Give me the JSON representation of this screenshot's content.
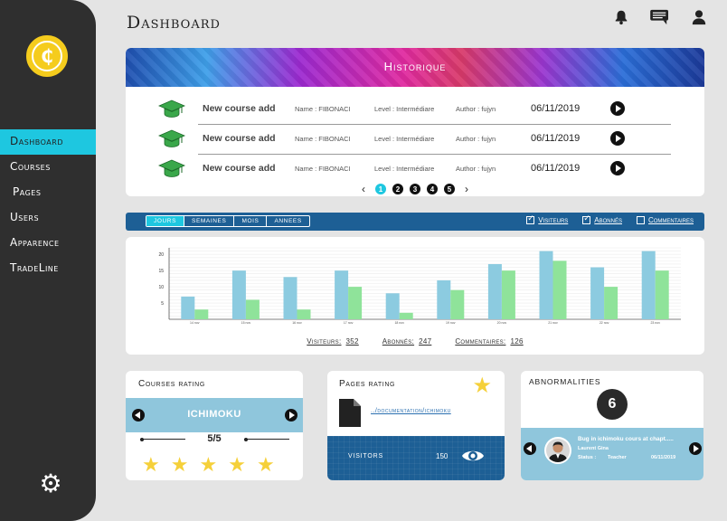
{
  "app": {
    "page_title": "Dashboard",
    "logo_symbol": "₵"
  },
  "sidebar": {
    "items": [
      {
        "label": "Dashboard",
        "active": true
      },
      {
        "label": "Courses"
      },
      {
        "label": "Pages"
      },
      {
        "label": "Users"
      },
      {
        "label": "Apparence"
      },
      {
        "label": "TradeLine"
      }
    ],
    "settings_icon": "gear-icon"
  },
  "header": {
    "icons": [
      "bell-icon",
      "chat-icon",
      "user-icon"
    ]
  },
  "historique": {
    "title": "Historique",
    "rows": [
      {
        "title": "New course add",
        "name": "Name : FIBONACI",
        "level": "Level : Intermédiare",
        "author": "Author : fujyn",
        "date": "06/11/2019"
      },
      {
        "title": "New course add",
        "name": "Name : FIBONACI",
        "level": "Level : Intermédiare",
        "author": "Author : fujyn",
        "date": "06/11/2019"
      },
      {
        "title": "New course add",
        "name": "Name : FIBONACI",
        "level": "Level : Intermédiare",
        "author": "Author : fujyn",
        "date": "06/11/2019"
      }
    ],
    "pages": [
      "1",
      "2",
      "3",
      "4",
      "5"
    ],
    "prev": "‹",
    "next": "›"
  },
  "filters": {
    "tabs": [
      "Jours",
      "Semaines",
      "Mois",
      "Annees"
    ],
    "checks": [
      {
        "label": "Visiteurs",
        "checked": true
      },
      {
        "label": "Abonnés",
        "checked": true
      },
      {
        "label": "Commentaires",
        "checked": false
      }
    ]
  },
  "chart_data": {
    "type": "bar",
    "categories": [
      "14 nov",
      "15 nov",
      "16 nov",
      "17 nov",
      "18 nov",
      "19 nov",
      "20 nov",
      "21 nov",
      "22 nov",
      "23 nov"
    ],
    "series": [
      {
        "name": "Visiteurs",
        "color": "#8ccbe0",
        "values": [
          7,
          15,
          13,
          15,
          8,
          12,
          17,
          21,
          16,
          21
        ]
      },
      {
        "name": "Abonnés",
        "color": "#8fe39a",
        "values": [
          3,
          6,
          3,
          10,
          2,
          9,
          15,
          18,
          10,
          15
        ]
      }
    ],
    "yticks": [
      "5",
      "10",
      "15",
      "20"
    ],
    "ylim": [
      0,
      22
    ],
    "grid": true
  },
  "totals": [
    {
      "label": "Visiteurs:",
      "value": "352"
    },
    {
      "label": "Abonnés:",
      "value": "247"
    },
    {
      "label": "Commentaires:",
      "value": "126"
    }
  ],
  "courses_rating": {
    "title": "Courses rating",
    "course": "ICHIMOKU",
    "score": "5/5",
    "stars": 5
  },
  "pages_rating": {
    "title": "Pages rating",
    "link": "../documentation/ichimoku",
    "visitors_label": "visitors",
    "visitors_value": "150"
  },
  "abnormalities": {
    "title": "abnormalities",
    "count": "6",
    "message": "Bug in ichimoku cours at chapt.....",
    "user": "Laurent Gina",
    "status_label": "Status :",
    "status_value": "Teacher",
    "date": "06/11/2019"
  }
}
